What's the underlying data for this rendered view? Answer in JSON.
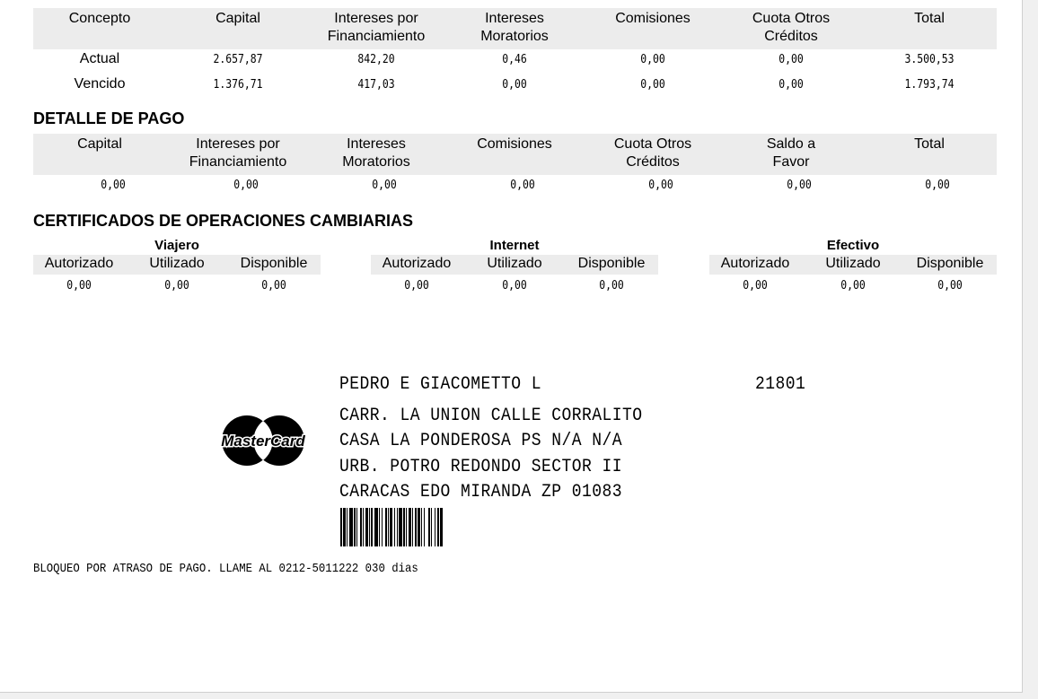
{
  "summary": {
    "headers": [
      "Concepto",
      "Capital",
      "Intereses por\nFinanciamiento",
      "Intereses\nMoratorios",
      "Comisiones",
      "Cuota Otros\nCréditos",
      "Total"
    ],
    "rows": [
      [
        "Actual",
        "2.657,87",
        "842,20",
        "0,46",
        "0,00",
        "0,00",
        "3.500,53"
      ],
      [
        "Vencido",
        "1.376,71",
        "417,03",
        "0,00",
        "0,00",
        "0,00",
        "1.793,74"
      ]
    ]
  },
  "payment": {
    "title": "DETALLE DE PAGO",
    "headers": [
      "Capital",
      "Intereses por\nFinanciamiento",
      "Intereses\nMoratorios",
      "Comisiones",
      "Cuota Otros\nCréditos",
      "Saldo a\nFavor",
      "Total"
    ],
    "values": [
      "0,00",
      "0,00",
      "0,00",
      "0,00",
      "0,00",
      "0,00",
      "0,00"
    ]
  },
  "certificates": {
    "title": "CERTIFICADOS DE OPERACIONES CAMBIARIAS",
    "groups": [
      {
        "name": "Viajero",
        "headers": [
          "Autorizado",
          "Utilizado",
          "Disponible"
        ],
        "values": [
          "0,00",
          "0,00",
          "0,00"
        ]
      },
      {
        "name": "Internet",
        "headers": [
          "Autorizado",
          "Utilizado",
          "Disponible"
        ],
        "values": [
          "0,00",
          "0,00",
          "0,00"
        ]
      },
      {
        "name": "Efectivo",
        "headers": [
          "Autorizado",
          "Utilizado",
          "Disponible"
        ],
        "values": [
          "0,00",
          "0,00",
          "0,00"
        ]
      }
    ]
  },
  "mailing": {
    "name": "PEDRO E GIACOMETTO L",
    "code": "21801",
    "address": [
      "CARR. LA UNION CALLE CORRALITO",
      "CASA LA PONDEROSA PS N/A N/A",
      "URB. POTRO REDONDO SECTOR II",
      "CARACAS EDO MIRANDA ZP 01083"
    ],
    "logo_text": "MasterCard"
  },
  "note": "BLOQUEO POR ATRASO DE PAGO. LLAME AL 0212-5011222 030 dias"
}
